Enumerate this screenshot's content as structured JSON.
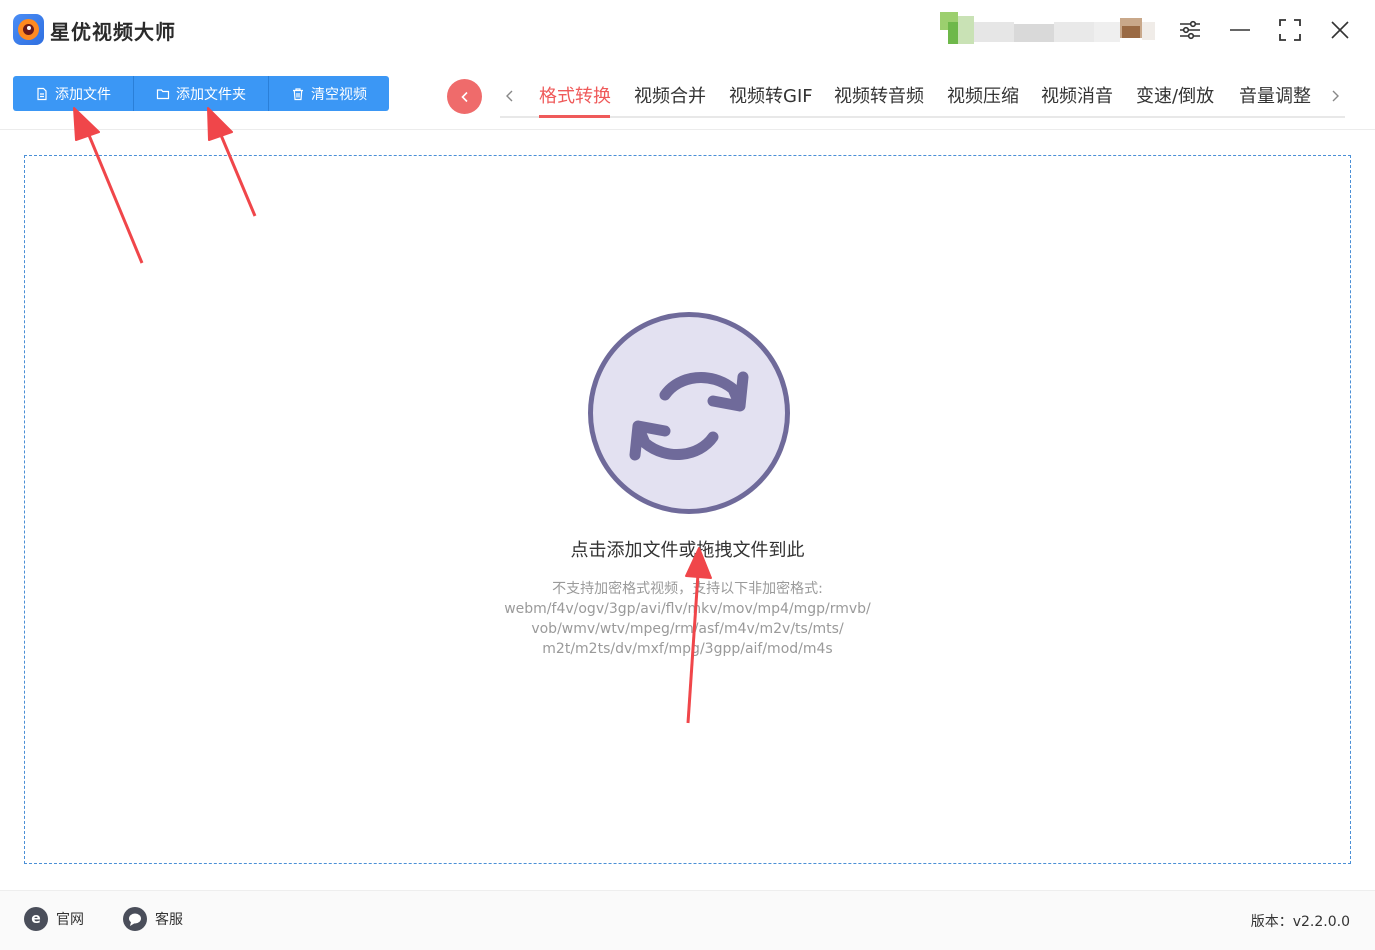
{
  "app": {
    "title": "星优视频大师"
  },
  "toolbar": {
    "add_file": "添加文件",
    "add_folder": "添加文件夹",
    "clear_videos": "清空视频"
  },
  "tabs": [
    {
      "label": "格式转换",
      "active": true
    },
    {
      "label": "视频合并"
    },
    {
      "label": "视频转GIF"
    },
    {
      "label": "视频转音频"
    },
    {
      "label": "视频压缩"
    },
    {
      "label": "视频消音"
    },
    {
      "label": "变速/倒放"
    },
    {
      "label": "音量调整"
    }
  ],
  "dropzone": {
    "title": "点击添加文件或拖拽文件到此",
    "hint_lines": [
      "不支持加密格式视频，支持以下非加密格式:",
      "webm/f4v/ogv/3gp/avi/flv/mkv/mov/mp4/mgp/rmvb/",
      "vob/wmv/wtv/mpeg/rm/asf/m4v/m2v/ts/mts/",
      "m2t/m2ts/dv/mxf/mpg/3gpp/aif/mod/m4s"
    ]
  },
  "footer": {
    "website": "官网",
    "support": "客服",
    "version": "版本：v2.2.0.0"
  },
  "icons": {
    "logo": "app-logo-icon",
    "settings": "sliders-icon",
    "minimize": "minimize-icon",
    "maximize": "maximize-icon",
    "close": "close-icon",
    "sync": "sync-icon"
  },
  "colors": {
    "primary_blue": "#3b97f5",
    "accent_red": "#ef5a5a",
    "sync_circle_fill": "#e3e1f1",
    "sync_circle_stroke": "#6f6a9a",
    "dropzone_border": "#4a8fd6",
    "annotation_arrow": "#f0464a"
  }
}
